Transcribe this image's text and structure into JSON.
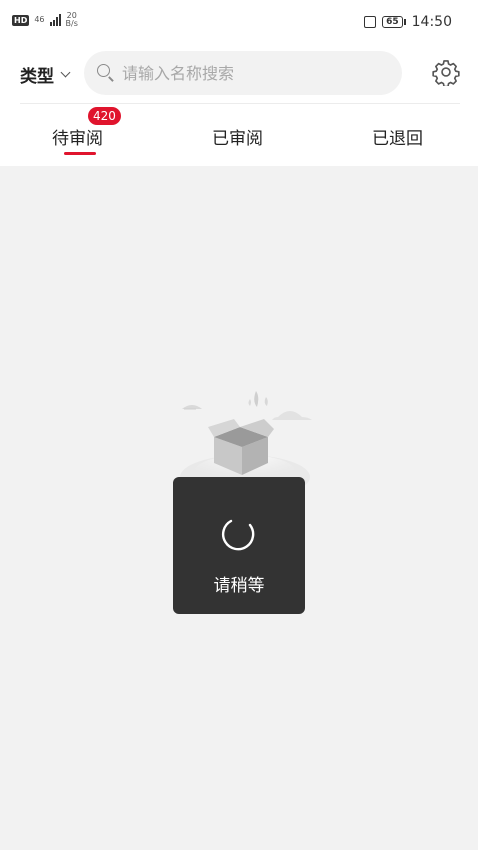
{
  "status_bar": {
    "hd_label": "HD",
    "network_type": "46",
    "net_rate_value": "20",
    "net_rate_unit": "B/s",
    "battery_level": "65",
    "time": "14:50"
  },
  "header": {
    "type_filter_label": "类型",
    "search_placeholder": "请输入名称搜索"
  },
  "tabs": [
    {
      "label": "待审阅",
      "badge": "420",
      "active": true
    },
    {
      "label": "已审阅"
    },
    {
      "label": "已退回"
    }
  ],
  "loading": {
    "message": "请稍等"
  },
  "colors": {
    "accent": "#e0142d",
    "toast_bg": "#333333",
    "page_bg": "#f2f2f2"
  }
}
